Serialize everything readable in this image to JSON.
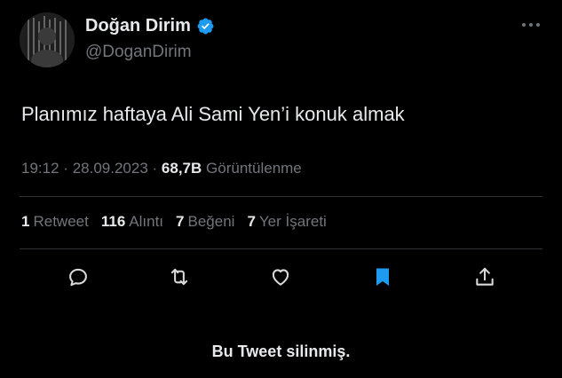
{
  "author": {
    "name": "Doğan Dirim",
    "handle": "@DoganDirim",
    "verified": true,
    "avatar_icon": "profile-photo-icon"
  },
  "tweet": {
    "text": "Planımız haftaya Ali Sami Yen’i konuk almak",
    "time": "19:12",
    "separator": "·",
    "date": "28.09.2023",
    "views_count": "68,7B",
    "views_label": "Görüntülenme"
  },
  "stats": [
    {
      "count": "1",
      "label": "Retweet"
    },
    {
      "count": "116",
      "label": "Alıntı"
    },
    {
      "count": "7",
      "label": "Beğeni"
    },
    {
      "count": "7",
      "label": "Yer İşareti"
    }
  ],
  "actions": [
    "reply-icon",
    "retweet-icon",
    "like-icon",
    "bookmark-icon",
    "share-icon"
  ],
  "notice": "Bu Tweet silinmiş.",
  "colors": {
    "background": "#000000",
    "text": "#e7e9ea",
    "muted": "#71767b",
    "divider": "#2f3336",
    "accent": "#1d9bf0"
  }
}
